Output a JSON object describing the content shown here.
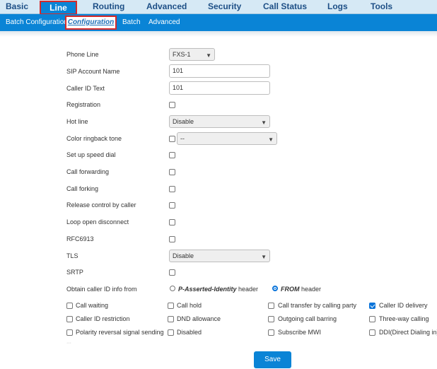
{
  "topnav": {
    "tabs": [
      {
        "label": "Basic",
        "active": false
      },
      {
        "label": "Line",
        "active": true
      },
      {
        "label": "Routing",
        "active": false
      },
      {
        "label": "Advanced",
        "active": false
      },
      {
        "label": "Security",
        "active": false
      },
      {
        "label": "Call Status",
        "active": false
      },
      {
        "label": "Logs",
        "active": false
      },
      {
        "label": "Tools",
        "active": false
      }
    ]
  },
  "subnav": {
    "items": [
      {
        "label": "Batch Configuration",
        "active": false
      },
      {
        "label": "Configuration",
        "active": true
      },
      {
        "label": "Batch",
        "active": false
      },
      {
        "label": "Advanced",
        "active": false
      }
    ]
  },
  "form": {
    "phone_line": {
      "label": "Phone Line",
      "value": "FXS-1"
    },
    "sip_account_name": {
      "label": "SIP Account Name",
      "value": "101"
    },
    "caller_id_text": {
      "label": "Caller ID Text",
      "value": "101"
    },
    "registration": {
      "label": "Registration",
      "checked": false
    },
    "hot_line": {
      "label": "Hot line",
      "value": "Disable"
    },
    "color_ringback_tone": {
      "label": "Color ringback tone",
      "checked": false,
      "value": "--"
    },
    "speed_dial": {
      "label": "Set up speed dial",
      "checked": false
    },
    "call_forwarding": {
      "label": "Call forwarding",
      "checked": false
    },
    "call_forking": {
      "label": "Call forking",
      "checked": false
    },
    "release_control": {
      "label": "Release control by caller",
      "checked": false
    },
    "loop_open_disconnect": {
      "label": "Loop open disconnect",
      "checked": false
    },
    "rfc6913": {
      "label": "RFC6913",
      "checked": false
    },
    "tls": {
      "label": "TLS",
      "value": "Disable"
    },
    "srtp": {
      "label": "SRTP",
      "checked": false
    },
    "caller_id_info": {
      "label": "Obtain caller ID info from",
      "option1_bold": "P-Asserted-Identity",
      "option1_suffix": " header",
      "option2_bold": "FROM",
      "option2_suffix": " header",
      "selected": "FROM"
    }
  },
  "options": {
    "row1": [
      {
        "label": "Call waiting",
        "checked": false
      },
      {
        "label": "Call hold",
        "checked": false
      },
      {
        "label": "Call transfer by calling party",
        "checked": false
      },
      {
        "label": "Caller ID delivery",
        "checked": true
      }
    ],
    "row2": [
      {
        "label": "Caller ID restriction",
        "checked": false
      },
      {
        "label": "DND allowance",
        "checked": false
      },
      {
        "label": "Outgoing call barring",
        "checked": false
      },
      {
        "label": "Three-way calling",
        "checked": false
      }
    ],
    "row3": [
      {
        "label": "Polarity reversal signal sending",
        "checked": false
      },
      {
        "label": "Disabled",
        "checked": false
      },
      {
        "label": "Subscribe MWI",
        "checked": false
      },
      {
        "label": "DDI(Direct Dialing in)",
        "checked": false
      }
    ]
  },
  "actions": {
    "save_label": "Save"
  },
  "colors": {
    "accent": "#0a84d6",
    "highlight_border": "#d42a2a",
    "nav_bg": "#d6e9f5"
  }
}
